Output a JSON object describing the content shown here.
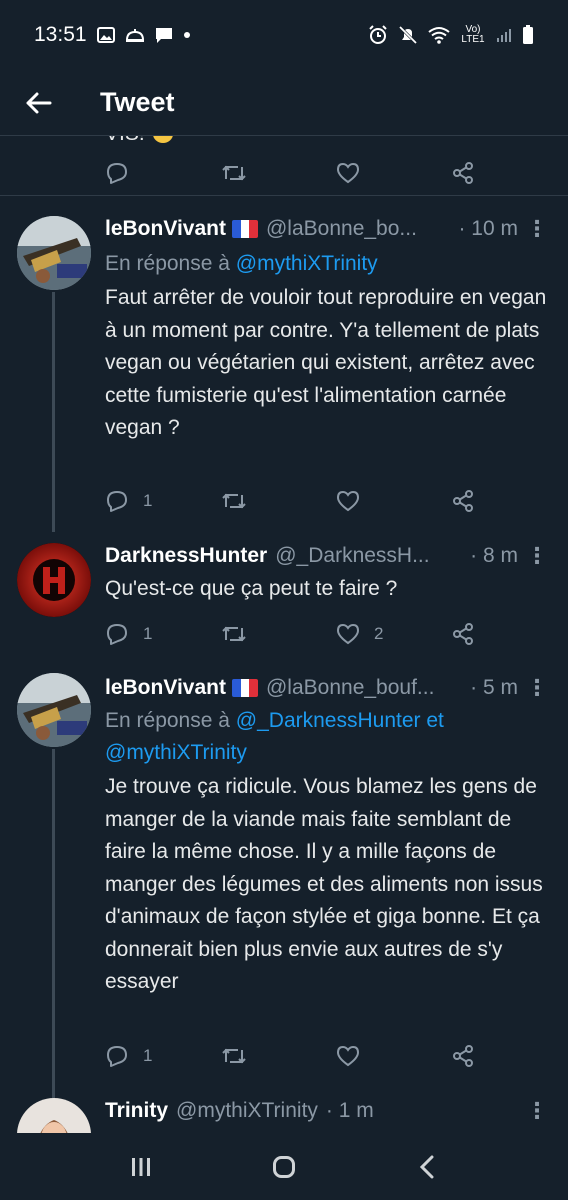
{
  "status": {
    "time": "13:51",
    "network": "Vo) LTE1"
  },
  "header": {
    "title": "Tweet"
  },
  "partial": {
    "text": "VIS!"
  },
  "tweets": [
    {
      "name": "leBonVivant",
      "handle": "@laBonne_bo...",
      "time": "· 10 m",
      "reply_prefix": "En réponse à",
      "reply_to": "@mythiXTrinity",
      "body": "Faut arrêter de vouloir tout reproduire en vegan à un moment par contre. Y'a tellement de plats vegan ou végétarien qui existent, arrêtez avec cette fumisterie qu'est l'alimentation carnée vegan ?",
      "replies": "1",
      "retweets": "",
      "likes": ""
    },
    {
      "name": "DarknessHunter",
      "handle": "@_DarknessH...",
      "time": "· 8 m",
      "body": "Qu'est-ce que ça peut te faire ?",
      "replies": "1",
      "retweets": "",
      "likes": "2"
    },
    {
      "name": "leBonVivant",
      "handle": "@laBonne_bouf...",
      "time": "· 5 m",
      "reply_prefix": "En réponse à",
      "reply_to": "@_DarknessHunter et @mythiXTrinity",
      "body": "Je trouve ça ridicule. Vous blamez les gens de manger de la viande mais faite semblant de faire la même chose. Il y a mille façons de manger des légumes et des aliments non issus d'animaux de façon stylée et giga bonne. Et ça donnerait bien plus envie aux autres de s'y essayer",
      "replies": "1",
      "retweets": "",
      "likes": ""
    },
    {
      "name": "Trinity",
      "handle": "@mythiXTrinity",
      "time": "· 1 m"
    }
  ],
  "colors": {
    "background": "#15202b",
    "accent": "#1d9bf0",
    "muted": "#8b98a5",
    "divider": "#2f3b47"
  }
}
